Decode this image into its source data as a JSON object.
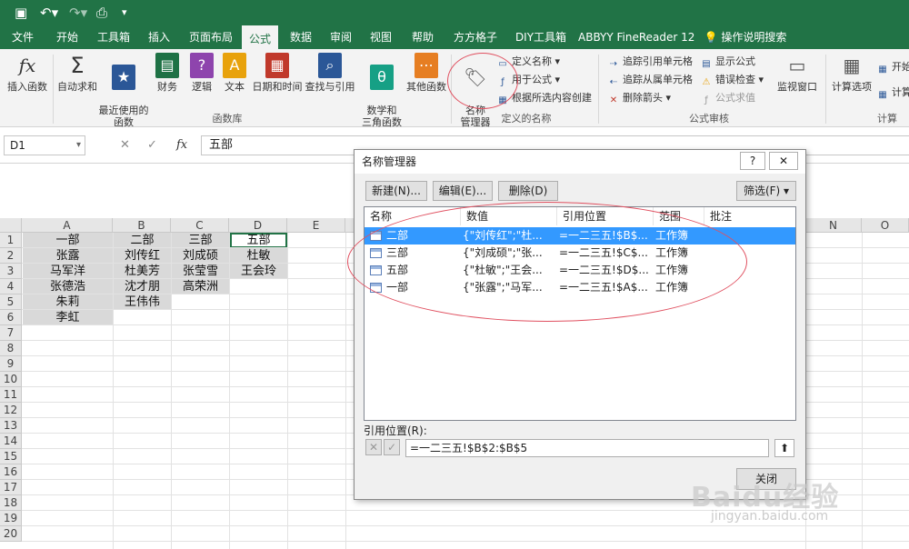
{
  "quick_access": {
    "save_icon": "save-icon",
    "undo_icon": "undo-icon",
    "redo_icon": "redo-icon",
    "preview_icon": "print-preview-icon"
  },
  "tabs": [
    "文件",
    "开始",
    "工具箱",
    "插入",
    "页面布局",
    "公式",
    "数据",
    "审阅",
    "视图",
    "帮助",
    "方方格子",
    "DIY工具箱",
    "ABBYY FineReader 12",
    "操作说明搜索"
  ],
  "active_tab": "公式",
  "ribbon": {
    "insert_function": "插入函数",
    "autosum": "自动求和",
    "recent": "最近使用的\n函数",
    "financial": "财务",
    "logical": "逻辑",
    "text": "文本",
    "datetime": "日期和时间",
    "lookup": "查找与引用",
    "math": "数学和\n三角函数",
    "more": "其他函数",
    "group_library": "函数库",
    "name_manager": "名称\n管理器",
    "define_name": "定义名称",
    "use_in_formula": "用于公式",
    "create_from_selection": "根据所选内容创建",
    "group_names": "定义的名称",
    "trace_precedents": "追踪引用单元格",
    "trace_dependents": "追踪从属单元格",
    "remove_arrows": "删除箭头",
    "show_formulas": "显示公式",
    "error_checking": "错误检查",
    "evaluate_formula": "公式求值",
    "watch_window": "监视窗口",
    "group_audit": "公式审核",
    "calc_options": "计算选项",
    "calc_now": "开始",
    "calc_sheet": "计算",
    "group_calc": "计算"
  },
  "formula_bar": {
    "name_box": "D1",
    "cancel": "✕",
    "enter": "✓",
    "fx": "fx",
    "content": "五部"
  },
  "columns": [
    "A",
    "B",
    "C",
    "D",
    "E",
    "N",
    "O"
  ],
  "rows": [
    "1",
    "2",
    "3",
    "4",
    "5",
    "6",
    "7",
    "8",
    "9",
    "10",
    "11",
    "12",
    "13",
    "14",
    "15",
    "16",
    "17",
    "18",
    "19",
    "20"
  ],
  "cells": {
    "A": [
      "一部",
      "张露",
      "马军洋",
      "张德浩",
      "朱莉",
      "李虹"
    ],
    "B": [
      "二部",
      "刘传红",
      "杜美芳",
      "沈才朋",
      "王伟伟"
    ],
    "C": [
      "三部",
      "刘成硕",
      "张莹雪",
      "高荣洲"
    ],
    "D": [
      "五部",
      "杜敏",
      "王会玲"
    ]
  },
  "dialog": {
    "title": "名称管理器",
    "help": "?",
    "close": "✕",
    "new_btn": "新建(N)...",
    "edit_btn": "编辑(E)...",
    "delete_btn": "删除(D)",
    "filter_btn": "筛选(F) ▾",
    "headers": [
      "名称",
      "数值",
      "引用位置",
      "范围",
      "批注"
    ],
    "rows": [
      {
        "name": "二部",
        "value": "{\"刘传红\";\"杜...",
        "ref": "=一二三五!$B$...",
        "scope": "工作簿",
        "comment": ""
      },
      {
        "name": "三部",
        "value": "{\"刘成硕\";\"张...",
        "ref": "=一二三五!$C$...",
        "scope": "工作簿",
        "comment": ""
      },
      {
        "name": "五部",
        "value": "{\"杜敏\";\"王会...",
        "ref": "=一二三五!$D$...",
        "scope": "工作簿",
        "comment": ""
      },
      {
        "name": "一部",
        "value": "{\"张露\";\"马军...",
        "ref": "=一二三五!$A$...",
        "scope": "工作簿",
        "comment": ""
      }
    ],
    "ref_label": "引用位置(R):",
    "ref_value": "=一二三五!$B$2:$B$5",
    "close_btn": "关闭"
  },
  "watermark": {
    "brand": "Baidu经验",
    "url": "jingyan.baidu.com"
  },
  "colors": {
    "excel_green": "#217346",
    "selection": "#3399ff",
    "annotation": "#e05060",
    "cell_fill": "#d9d9d9"
  }
}
